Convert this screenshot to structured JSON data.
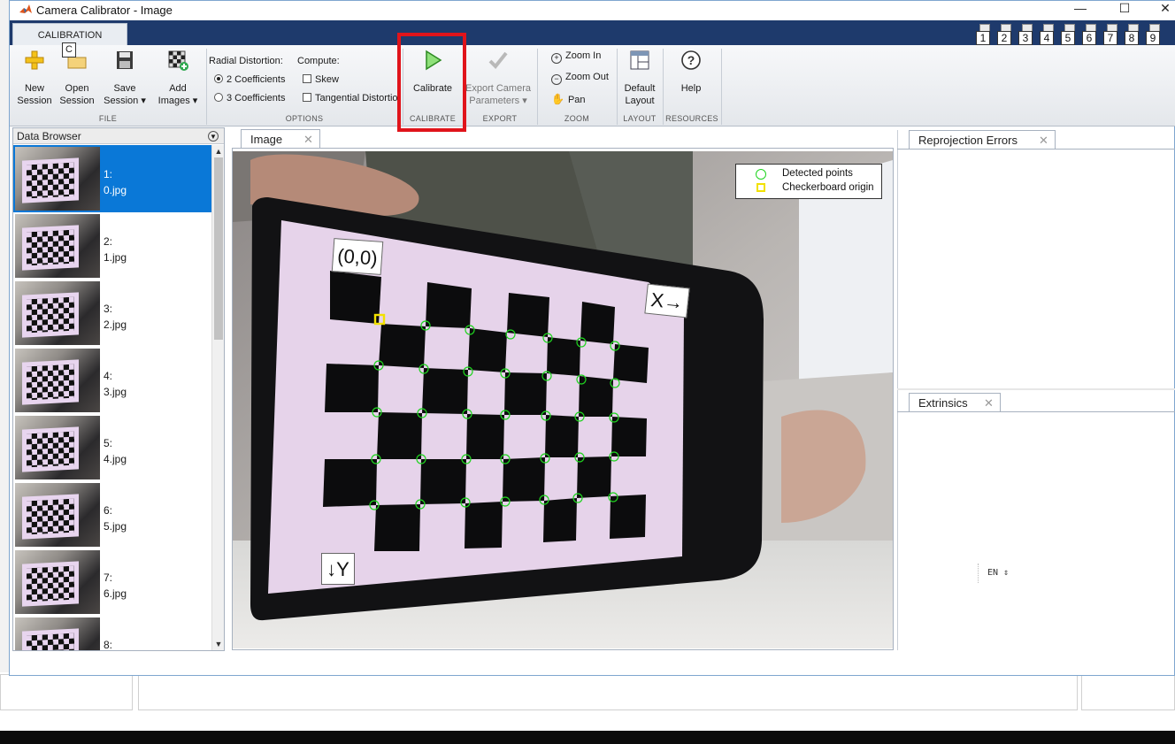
{
  "window": {
    "title": "Camera Calibrator - Image",
    "minimize": "—",
    "maximize": "☐",
    "close": "✕"
  },
  "tabs": {
    "calibration": "CALIBRATION",
    "shortcut": "C"
  },
  "quick_access": [
    "1",
    "2",
    "3",
    "4",
    "5",
    "6",
    "7",
    "8",
    "9"
  ],
  "ribbon": {
    "file": {
      "label": "FILE",
      "new_session": "New\nSession",
      "open_session": "Open\nSession",
      "save_session": "Save\nSession ▾",
      "add_images": "Add\nImages ▾"
    },
    "options": {
      "label": "OPTIONS",
      "radial_distortion": "Radial Distortion:",
      "compute": "Compute:",
      "coef2": "2 Coefficients",
      "coef3": "3 Coefficients",
      "skew": "Skew",
      "tangential": "Tangential Distortion",
      "selected_radial": "2 Coefficients",
      "skew_checked": false,
      "tangential_checked": false
    },
    "calibrate": {
      "label": "CALIBRATE",
      "button": "Calibrate"
    },
    "export": {
      "label": "EXPORT",
      "button": "Export Camera\nParameters ▾"
    },
    "zoom": {
      "label": "ZOOM",
      "zoom_in": "Zoom In",
      "zoom_out": "Zoom Out",
      "pan": "Pan"
    },
    "layout": {
      "label": "LAYOUT",
      "default_layout": "Default\nLayout"
    },
    "resources": {
      "label": "RESOURCES",
      "help": "Help"
    }
  },
  "data_browser": {
    "title": "Data Browser",
    "items": [
      {
        "label": "1:\n0.jpg",
        "selected": true
      },
      {
        "label": "2:\n1.jpg",
        "selected": false
      },
      {
        "label": "3:\n2.jpg",
        "selected": false
      },
      {
        "label": "4:\n3.jpg",
        "selected": false
      },
      {
        "label": "5:\n4.jpg",
        "selected": false
      },
      {
        "label": "6:\n5.jpg",
        "selected": false
      },
      {
        "label": "7:\n6.jpg",
        "selected": false
      },
      {
        "label": "8:",
        "selected": false
      }
    ]
  },
  "image_panel": {
    "tab": "Image",
    "legend": {
      "detected": "Detected points",
      "origin": "Checkerboard origin"
    },
    "origin_label": "(0,0)",
    "x_label": "X→",
    "y_label": "↓Y"
  },
  "panels": {
    "reprojection": "Reprojection Errors",
    "extrinsics": "Extrinsics"
  },
  "ime": "EN",
  "colors": {
    "accent_blue": "#0a78d7",
    "highlight_red": "#e0141b",
    "detected_green": "#1fd41f",
    "origin_yellow": "#f2e100"
  }
}
